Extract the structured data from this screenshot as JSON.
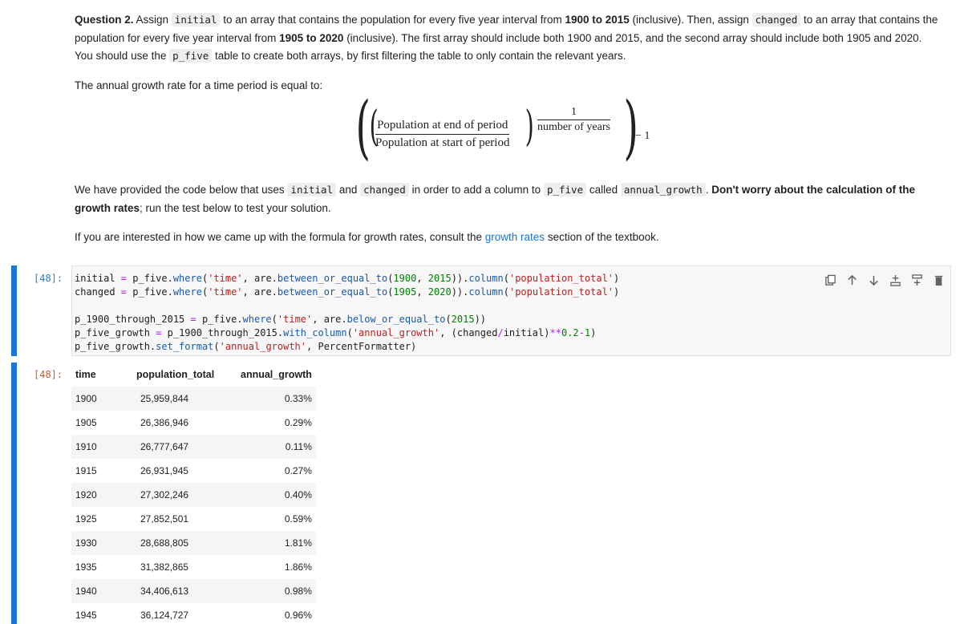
{
  "markdown": {
    "q_label": "Question 2.",
    "q_text_1": " Assign ",
    "code_initial": "initial",
    "q_text_2": " to an array that contains the population for every five year interval from ",
    "bold_range_1": "1900 to 2015",
    "q_text_3": " (inclusive). Then, assign ",
    "code_changed": "changed",
    "q_text_4": " to an array that contains the population for every five year interval from ",
    "bold_range_2": "1905 to 2020",
    "q_text_5": " (inclusive). The first array should include both 1900 and 2015, and the second array should include both 1905 and 2020. You should use the ",
    "code_p_five": "p_five",
    "q_text_6": " table to create both arrays, by first filtering the table to only contain the relevant years.",
    "growth_intro": "The annual growth rate for a time period is equal to:",
    "provided_1": "We have provided the code below that uses ",
    "provided_code_initial": "initial",
    "provided_and": " and ",
    "provided_code_changed": "changed",
    "provided_2": " in order to add a column to ",
    "provided_code_p_five": "p_five",
    "provided_3": " called ",
    "provided_code_annual": "annual_growth",
    "provided_4": ". ",
    "provided_bold": "Don't worry about the calculation of the growth rates",
    "provided_5": "; run the test below to test your solution.",
    "interest_1": "If you are interested in how we came up with the formula for growth rates, consult the ",
    "interest_link": "growth rates",
    "interest_2": " section of the textbook."
  },
  "formula": {
    "numerator": "Population at end of period",
    "denominator": "Population at start of period",
    "exp_num": "1",
    "exp_den": "number of years",
    "minus_one": "− 1"
  },
  "cell": {
    "in_prompt": "[48]:",
    "out_prompt": "[48]:"
  },
  "toolbar": {
    "icons": [
      "copy-icon",
      "move-up-icon",
      "move-down-icon",
      "insert-above-icon",
      "insert-below-icon",
      "delete-icon"
    ]
  },
  "output_table": {
    "headers": [
      "time",
      "population_total",
      "annual_growth"
    ],
    "rows": [
      [
        "1900",
        "25,959,844",
        "0.33%"
      ],
      [
        "1905",
        "26,386,946",
        "0.29%"
      ],
      [
        "1910",
        "26,777,647",
        "0.11%"
      ],
      [
        "1915",
        "26,931,945",
        "0.27%"
      ],
      [
        "1920",
        "27,302,246",
        "0.40%"
      ],
      [
        "1925",
        "27,852,501",
        "0.59%"
      ],
      [
        "1930",
        "28,688,805",
        "1.81%"
      ],
      [
        "1935",
        "31,382,865",
        "1.86%"
      ],
      [
        "1940",
        "34,406,613",
        "0.98%"
      ],
      [
        "1945",
        "36,124,727",
        "0.96%"
      ]
    ]
  },
  "colors": {
    "accent": "#1976d2",
    "in_prompt": "#307fc1",
    "out_prompt": "#bf5b3d",
    "code_bg": "#f7f7f7"
  }
}
